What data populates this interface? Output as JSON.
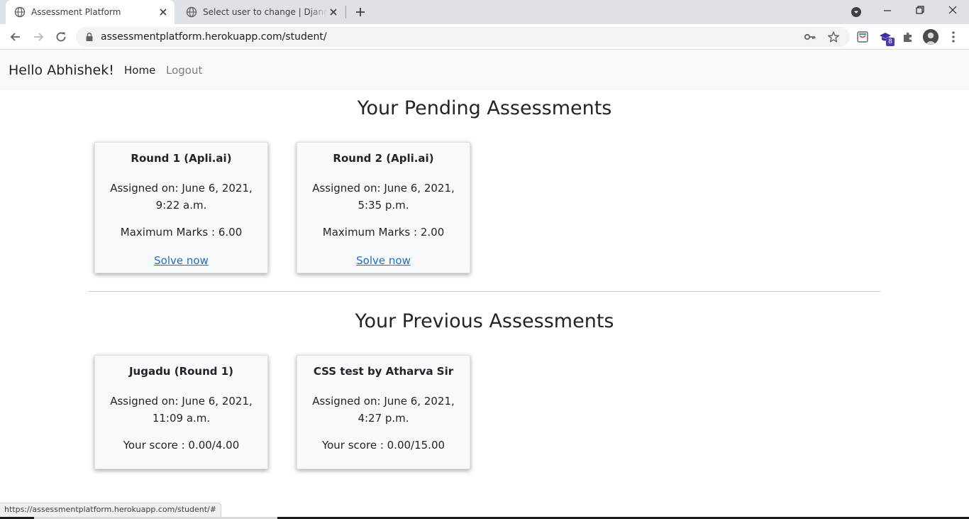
{
  "browser": {
    "tabs": [
      {
        "title": "Assessment Platform",
        "active": true
      },
      {
        "title": "Select user to change | Django site admin",
        "active": false
      }
    ],
    "url": "assessmentplatform.herokuapp.com/student/",
    "extension_badge": "8",
    "status_url": "https://assessmentplatform.herokuapp.com/student/#"
  },
  "navbar": {
    "brand": "Hello Abhishek!",
    "links": [
      {
        "label": "Home"
      },
      {
        "label": "Logout"
      }
    ]
  },
  "pending": {
    "heading": "Your Pending Assessments",
    "cards": [
      {
        "title": "Round 1 (Apli.ai)",
        "assigned": "Assigned on: June 6, 2021, 9:22 a.m.",
        "marks": "Maximum Marks : 6.00",
        "action": "Solve now"
      },
      {
        "title": "Round 2 (Apli.ai)",
        "assigned": "Assigned on: June 6, 2021, 5:35 p.m.",
        "marks": "Maximum Marks : 2.00",
        "action": "Solve now"
      }
    ]
  },
  "previous": {
    "heading": "Your Previous Assessments",
    "cards": [
      {
        "title": "Jugadu (Round 1)",
        "assigned": "Assigned on: June 6, 2021, 11:09 a.m.",
        "score": "Your score : 0.00/4.00"
      },
      {
        "title": "CSS test by Atharva Sir",
        "assigned": "Assigned on: June 6, 2021, 4:27 p.m.",
        "score": "Your score : 0.00/15.00"
      }
    ]
  },
  "icons": {
    "tab_favicon": "globe-icon",
    "tab_close": "close-icon",
    "new_tab": "plus-icon",
    "back": "arrow-left-icon",
    "forward": "arrow-right-icon",
    "reload": "reload-icon",
    "lock": "lock-icon",
    "key": "key-icon",
    "bookmark": "star-icon",
    "extensions": "puzzle-icon",
    "menu": "kebab-menu-icon"
  },
  "colors": {
    "navbar_bg": "#f8f9fa",
    "card_bg": "#f8f9fa",
    "link": "#1e6fc9",
    "text": "#212529",
    "muted": "#7b7f83"
  }
}
